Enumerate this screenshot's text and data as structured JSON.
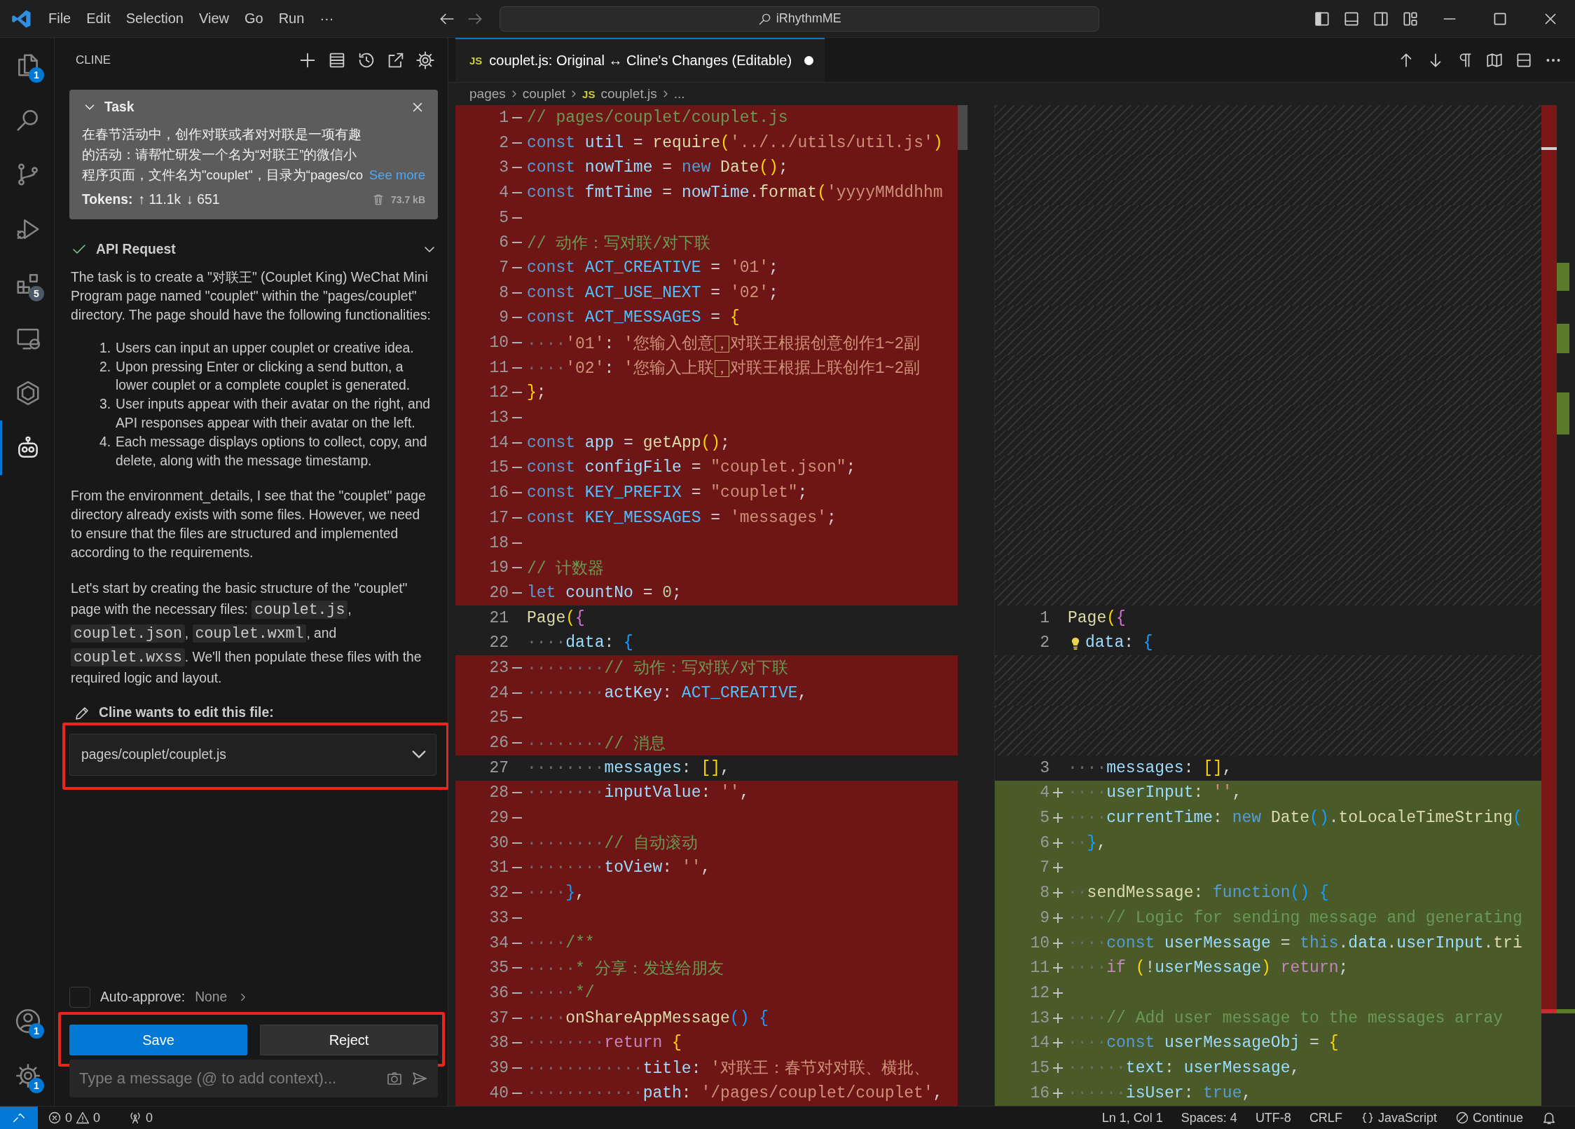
{
  "title_bar": {
    "menus": [
      "File",
      "Edit",
      "Selection",
      "View",
      "Go",
      "Run",
      "···"
    ],
    "command_center": "iRhythmME"
  },
  "activity_bar": {
    "items": [
      {
        "kind": "explorer",
        "badge": "1",
        "selected": false
      },
      {
        "kind": "search",
        "selected": false
      },
      {
        "kind": "scm",
        "selected": false
      },
      {
        "kind": "debug",
        "selected": false
      },
      {
        "kind": "extensions",
        "badge": "5",
        "selected": false
      },
      {
        "kind": "remote",
        "selected": false
      },
      {
        "kind": "hexagon",
        "selected": false
      },
      {
        "kind": "robot",
        "selected": true
      }
    ],
    "bottom": [
      {
        "kind": "account",
        "badge": "1"
      },
      {
        "kind": "settings",
        "badge": "1"
      }
    ]
  },
  "sidebar": {
    "title": "CLINE",
    "task": {
      "heading": "Task",
      "text": "在春节活动中，创作对联或者对对联是一项有趣的活动：请帮忙研发一个名为“对联王”的微信小程序页面，文件名为\"couplet\"，目录为“pages/co",
      "see_more": "See more",
      "tokens_label": "Tokens:",
      "tokens_up": "↑ 11.1k",
      "tokens_down": "↓ 651",
      "size": "73.7 kB"
    },
    "api_request": {
      "title": "API Request",
      "expanded": false
    },
    "paragraphs_before": [
      "The task is to create a \"对联王\" (Couplet King) WeChat Mini Program page named \"couplet\" within the \"pages/couplet\" directory. The page should have the following functionalities:"
    ],
    "list": [
      {
        "number": "1.",
        "text": "Users can input an upper couplet or creative idea."
      },
      {
        "number": "2.",
        "text": "Upon pressing Enter or clicking a send button, a lower couplet or a complete couplet is generated."
      },
      {
        "number": "3.",
        "text": "User inputs appear with their avatar on the right, and API responses appear with their avatar on the left."
      },
      {
        "number": "4.",
        "text": "Each message displays options to collect, copy, and delete, along with the message timestamp."
      }
    ],
    "paragraphs_after": [
      [
        {
          "kind": "text",
          "text": "From the environment_details, I see that the \"couplet\" page directory already exists with some files. However, we need to ensure that the files are structured and implemented according to the requirements."
        }
      ],
      [
        {
          "kind": "text",
          "text": "Let's start by creating the basic structure of the \"couplet\" page with the necessary files: "
        },
        {
          "kind": "code",
          "text": "couplet.js"
        },
        {
          "kind": "text",
          "text": ", "
        },
        {
          "kind": "code",
          "text": "couplet.json"
        },
        {
          "kind": "text",
          "text": ", "
        },
        {
          "kind": "code",
          "text": "couplet.wxml"
        },
        {
          "kind": "text",
          "text": ", and "
        },
        {
          "kind": "code",
          "text": "couplet.wxss"
        },
        {
          "kind": "text",
          "text": ". We'll then populate these files with the required logic and layout."
        }
      ]
    ],
    "edit_request": {
      "label": "Cline wants to edit this file:",
      "file": "pages/couplet/couplet.js"
    },
    "auto_approve": {
      "label": "Auto-approve:",
      "value": "None",
      "checked": false
    },
    "buttons": [
      {
        "label": "Save",
        "primary": true
      },
      {
        "label": "Reject",
        "primary": false
      }
    ],
    "input": {
      "placeholder": "Type a message (@ to add context)..."
    }
  },
  "editor": {
    "tab": {
      "icon_text": "JS",
      "title": "couplet.js: Original ↔ Cline's Changes (Editable)",
      "dirty": true
    },
    "breadcrumb": [
      {
        "text": "pages"
      },
      {
        "text": "couplet"
      },
      {
        "text": "couplet.js",
        "icon_text": "JS"
      },
      {
        "text": "..."
      }
    ],
    "left_pane": {
      "lines": [
        {
          "number": "1",
          "removed": true,
          "tokens": [
            {
              "kind": "comment",
              "text": "// pages/couplet/couplet.js"
            }
          ]
        },
        {
          "number": "2",
          "removed": true,
          "tokens": [
            {
              "kind": "keyword",
              "text": "const "
            },
            {
              "kind": "name",
              "text": "util"
            },
            {
              "kind": "punct",
              "text": " = "
            },
            {
              "kind": "func",
              "text": "require"
            },
            {
              "kind": "gold",
              "text": "("
            },
            {
              "kind": "string",
              "text": "'../../utils/util.js'"
            },
            {
              "kind": "gold",
              "text": ")"
            }
          ]
        },
        {
          "number": "3",
          "removed": true,
          "tokens": [
            {
              "kind": "keyword",
              "text": "const "
            },
            {
              "kind": "name",
              "text": "nowTime"
            },
            {
              "kind": "punct",
              "text": " = "
            },
            {
              "kind": "keyword",
              "text": "new "
            },
            {
              "kind": "func",
              "text": "Date"
            },
            {
              "kind": "gold",
              "text": "()"
            },
            {
              "kind": "punct",
              "text": ";"
            }
          ]
        },
        {
          "number": "4",
          "removed": true,
          "tokens": [
            {
              "kind": "keyword",
              "text": "const "
            },
            {
              "kind": "name",
              "text": "fmtTime"
            },
            {
              "kind": "punct",
              "text": " = "
            },
            {
              "kind": "name",
              "text": "nowTime"
            },
            {
              "kind": "punct",
              "text": "."
            },
            {
              "kind": "func",
              "text": "format"
            },
            {
              "kind": "gold",
              "text": "("
            },
            {
              "kind": "string",
              "text": "'yyyyMMddhhm"
            }
          ]
        },
        {
          "number": "5",
          "removed": true
        },
        {
          "number": "6",
          "removed": true,
          "tokens": [
            {
              "kind": "comment",
              "text": "// 动作：写对联/对下联"
            }
          ]
        },
        {
          "number": "7",
          "removed": true,
          "tokens": [
            {
              "kind": "keyword",
              "text": "const "
            },
            {
              "kind": "const",
              "text": "ACT_CREATIVE"
            },
            {
              "kind": "punct",
              "text": " = "
            },
            {
              "kind": "string",
              "text": "'01'"
            },
            {
              "kind": "punct",
              "text": ";"
            }
          ]
        },
        {
          "number": "8",
          "removed": true,
          "tokens": [
            {
              "kind": "keyword",
              "text": "const "
            },
            {
              "kind": "const",
              "text": "ACT_USE_NEXT"
            },
            {
              "kind": "punct",
              "text": " = "
            },
            {
              "kind": "string",
              "text": "'02'"
            },
            {
              "kind": "punct",
              "text": ";"
            }
          ]
        },
        {
          "number": "9",
          "removed": true,
          "tokens": [
            {
              "kind": "keyword",
              "text": "const "
            },
            {
              "kind": "const",
              "text": "ACT_MESSAGES"
            },
            {
              "kind": "punct",
              "text": " = "
            },
            {
              "kind": "gold",
              "text": "{"
            }
          ]
        },
        {
          "number": "10",
          "removed": true,
          "tokens": [
            {
              "kind": "space",
              "text": "····"
            },
            {
              "kind": "string",
              "text": "'01'"
            },
            {
              "kind": "punct",
              "text": ": "
            },
            {
              "kind": "string",
              "text": "'您输入创意"
            },
            {
              "kind": "flag",
              "text": "，"
            },
            {
              "kind": "string",
              "text": "对联王根据创意创作1~2副"
            }
          ]
        },
        {
          "number": "11",
          "removed": true,
          "tokens": [
            {
              "kind": "space",
              "text": "····"
            },
            {
              "kind": "string",
              "text": "'02'"
            },
            {
              "kind": "punct",
              "text": ": "
            },
            {
              "kind": "string",
              "text": "'您输入上联"
            },
            {
              "kind": "flag",
              "text": "，"
            },
            {
              "kind": "string",
              "text": "对联王根据上联创作1~2副"
            }
          ]
        },
        {
          "number": "12",
          "removed": true,
          "tokens": [
            {
              "kind": "gold",
              "text": "}"
            },
            {
              "kind": "punct",
              "text": ";"
            }
          ]
        },
        {
          "number": "13",
          "removed": true
        },
        {
          "number": "14",
          "removed": true,
          "tokens": [
            {
              "kind": "keyword",
              "text": "const "
            },
            {
              "kind": "name",
              "text": "app"
            },
            {
              "kind": "punct",
              "text": " = "
            },
            {
              "kind": "func",
              "text": "getApp"
            },
            {
              "kind": "gold",
              "text": "()"
            },
            {
              "kind": "punct",
              "text": ";"
            }
          ]
        },
        {
          "number": "15",
          "removed": true,
          "tokens": [
            {
              "kind": "keyword",
              "text": "const "
            },
            {
              "kind": "name",
              "text": "configFile"
            },
            {
              "kind": "punct",
              "text": " = "
            },
            {
              "kind": "string",
              "text": "\"couplet.json\""
            },
            {
              "kind": "punct",
              "text": ";"
            }
          ]
        },
        {
          "number": "16",
          "removed": true,
          "tokens": [
            {
              "kind": "keyword",
              "text": "const "
            },
            {
              "kind": "const",
              "text": "KEY_PREFIX"
            },
            {
              "kind": "punct",
              "text": " = "
            },
            {
              "kind": "string",
              "text": "\"couplet\""
            },
            {
              "kind": "punct",
              "text": ";"
            }
          ]
        },
        {
          "number": "17",
          "removed": true,
          "tokens": [
            {
              "kind": "keyword",
              "text": "const "
            },
            {
              "kind": "const",
              "text": "KEY_MESSAGES"
            },
            {
              "kind": "punct",
              "text": " = "
            },
            {
              "kind": "string",
              "text": "'messages'"
            },
            {
              "kind": "punct",
              "text": ";"
            }
          ]
        },
        {
          "number": "18",
          "removed": true
        },
        {
          "number": "19",
          "removed": true,
          "tokens": [
            {
              "kind": "comment",
              "text": "// 计数器"
            }
          ]
        },
        {
          "number": "20",
          "removed": true,
          "tokens": [
            {
              "kind": "keyword",
              "text": "let "
            },
            {
              "kind": "name",
              "text": "countNo"
            },
            {
              "kind": "punct",
              "text": " = "
            },
            {
              "kind": "number",
              "text": "0"
            },
            {
              "kind": "punct",
              "text": ";"
            }
          ]
        },
        {
          "number": "21",
          "removed": false,
          "tokens": [
            {
              "kind": "func",
              "text": "Page"
            },
            {
              "kind": "gold",
              "text": "("
            },
            {
              "kind": "purple",
              "text": "{"
            }
          ]
        },
        {
          "number": "22",
          "removed": false,
          "tokens": [
            {
              "kind": "space",
              "text": "····"
            },
            {
              "kind": "name",
              "text": "data"
            },
            {
              "kind": "punct",
              "text": ": "
            },
            {
              "kind": "blue",
              "text": "{"
            }
          ]
        },
        {
          "number": "23",
          "removed": true,
          "tokens": [
            {
              "kind": "space",
              "text": "········"
            },
            {
              "kind": "comment",
              "text": "// 动作：写对联/对下联"
            }
          ]
        },
        {
          "number": "24",
          "removed": true,
          "tokens": [
            {
              "kind": "space",
              "text": "········"
            },
            {
              "kind": "name",
              "text": "actKey"
            },
            {
              "kind": "punct",
              "text": ": "
            },
            {
              "kind": "const",
              "text": "ACT_CREATIVE"
            },
            {
              "kind": "punct",
              "text": ","
            }
          ]
        },
        {
          "number": "25",
          "removed": true
        },
        {
          "number": "26",
          "removed": true,
          "tokens": [
            {
              "kind": "space",
              "text": "········"
            },
            {
              "kind": "comment",
              "text": "// 消息"
            }
          ]
        },
        {
          "number": "27",
          "removed": false,
          "tokens": [
            {
              "kind": "space",
              "text": "········"
            },
            {
              "kind": "name",
              "text": "messages"
            },
            {
              "kind": "punct",
              "text": ": "
            },
            {
              "kind": "gold",
              "text": "[]"
            },
            {
              "kind": "punct",
              "text": ","
            }
          ]
        },
        {
          "number": "28",
          "removed": true,
          "tokens": [
            {
              "kind": "space",
              "text": "········"
            },
            {
              "kind": "name",
              "text": "inputValue"
            },
            {
              "kind": "punct",
              "text": ": "
            },
            {
              "kind": "string",
              "text": "''"
            },
            {
              "kind": "punct",
              "text": ","
            }
          ]
        },
        {
          "number": "29",
          "removed": true
        },
        {
          "number": "30",
          "removed": true,
          "tokens": [
            {
              "kind": "space",
              "text": "········"
            },
            {
              "kind": "comment",
              "text": "// 自动滚动"
            }
          ]
        },
        {
          "number": "31",
          "removed": true,
          "tokens": [
            {
              "kind": "space",
              "text": "········"
            },
            {
              "kind": "name",
              "text": "toView"
            },
            {
              "kind": "punct",
              "text": ": "
            },
            {
              "kind": "string",
              "text": "''"
            },
            {
              "kind": "punct",
              "text": ","
            }
          ]
        },
        {
          "number": "32",
          "removed": true,
          "tokens": [
            {
              "kind": "space",
              "text": "····"
            },
            {
              "kind": "blue",
              "text": "}"
            },
            {
              "kind": "punct",
              "text": ","
            }
          ]
        },
        {
          "number": "33",
          "removed": true
        },
        {
          "number": "34",
          "removed": true,
          "tokens": [
            {
              "kind": "space",
              "text": "····"
            },
            {
              "kind": "comment",
              "text": "/**"
            }
          ]
        },
        {
          "number": "35",
          "removed": true,
          "tokens": [
            {
              "kind": "space",
              "text": "·····"
            },
            {
              "kind": "comment",
              "text": "* 分享：发送给朋友"
            }
          ]
        },
        {
          "number": "36",
          "removed": true,
          "tokens": [
            {
              "kind": "space",
              "text": "·····"
            },
            {
              "kind": "comment",
              "text": "*/"
            }
          ]
        },
        {
          "number": "37",
          "removed": true,
          "tokens": [
            {
              "kind": "space",
              "text": "····"
            },
            {
              "kind": "func",
              "text": "onShareAppMessage"
            },
            {
              "kind": "blue",
              "text": "() {"
            }
          ]
        },
        {
          "number": "38",
          "removed": true,
          "tokens": [
            {
              "kind": "space",
              "text": "········"
            },
            {
              "kind": "control",
              "text": "return "
            },
            {
              "kind": "gold",
              "text": "{"
            }
          ]
        },
        {
          "number": "39",
          "removed": true,
          "tokens": [
            {
              "kind": "space",
              "text": "············"
            },
            {
              "kind": "name",
              "text": "title"
            },
            {
              "kind": "punct",
              "text": ": "
            },
            {
              "kind": "string",
              "text": "'对联王：春节对对联、横批、"
            }
          ]
        },
        {
          "number": "40",
          "removed": true,
          "tokens": [
            {
              "kind": "space",
              "text": "············"
            },
            {
              "kind": "name",
              "text": "path"
            },
            {
              "kind": "punct",
              "text": ": "
            },
            {
              "kind": "string",
              "text": "'/pages/couplet/couplet'"
            },
            {
              "kind": "punct",
              "text": ","
            }
          ]
        }
      ]
    },
    "right_pane": {
      "rows": [
        {
          "kind": "filler"
        },
        {
          "kind": "filler"
        },
        {
          "kind": "filler"
        },
        {
          "kind": "filler"
        },
        {
          "kind": "filler"
        },
        {
          "kind": "filler"
        },
        {
          "kind": "filler"
        },
        {
          "kind": "filler"
        },
        {
          "kind": "filler"
        },
        {
          "kind": "filler"
        },
        {
          "kind": "filler"
        },
        {
          "kind": "filler"
        },
        {
          "kind": "filler"
        },
        {
          "kind": "filler"
        },
        {
          "kind": "filler"
        },
        {
          "kind": "filler"
        },
        {
          "kind": "filler"
        },
        {
          "kind": "filler"
        },
        {
          "kind": "filler"
        },
        {
          "kind": "filler"
        },
        {
          "kind": "line",
          "number": "1",
          "added": false,
          "lightbulb": false,
          "tokens": [
            {
              "kind": "func",
              "text": "Page"
            },
            {
              "kind": "gold",
              "text": "("
            },
            {
              "kind": "purple",
              "text": "{"
            }
          ]
        },
        {
          "kind": "line",
          "number": "2",
          "added": false,
          "lightbulb": true,
          "tokens": [
            {
              "kind": "name",
              "text": "data"
            },
            {
              "kind": "punct",
              "text": ": "
            },
            {
              "kind": "blue",
              "text": "{"
            }
          ]
        },
        {
          "kind": "filler"
        },
        {
          "kind": "filler"
        },
        {
          "kind": "filler"
        },
        {
          "kind": "filler"
        },
        {
          "kind": "line",
          "number": "3",
          "added": false,
          "lightbulb": false,
          "tokens": [
            {
              "kind": "space",
              "text": "····"
            },
            {
              "kind": "name",
              "text": "messages"
            },
            {
              "kind": "punct",
              "text": ": "
            },
            {
              "kind": "gold",
              "text": "[]"
            },
            {
              "kind": "punct",
              "text": ","
            }
          ]
        },
        {
          "kind": "line",
          "number": "4",
          "added": true,
          "lightbulb": false,
          "tokens": [
            {
              "kind": "space",
              "text": "····"
            },
            {
              "kind": "name",
              "text": "userInput"
            },
            {
              "kind": "punct",
              "text": ": "
            },
            {
              "kind": "string",
              "text": "''"
            },
            {
              "kind": "punct",
              "text": ","
            }
          ]
        },
        {
          "kind": "line",
          "number": "5",
          "added": true,
          "lightbulb": false,
          "tokens": [
            {
              "kind": "space",
              "text": "····"
            },
            {
              "kind": "name",
              "text": "currentTime"
            },
            {
              "kind": "punct",
              "text": ": "
            },
            {
              "kind": "keyword",
              "text": "new "
            },
            {
              "kind": "func",
              "text": "Date"
            },
            {
              "kind": "blue",
              "text": "()"
            },
            {
              "kind": "punct",
              "text": "."
            },
            {
              "kind": "func",
              "text": "toLocaleTimeString"
            },
            {
              "kind": "blue",
              "text": "("
            }
          ]
        },
        {
          "kind": "line",
          "number": "6",
          "added": true,
          "lightbulb": false,
          "tokens": [
            {
              "kind": "space",
              "text": "··"
            },
            {
              "kind": "blue",
              "text": "}"
            },
            {
              "kind": "punct",
              "text": ","
            }
          ]
        },
        {
          "kind": "line",
          "number": "7",
          "added": true,
          "lightbulb": false
        },
        {
          "kind": "line",
          "number": "8",
          "added": true,
          "lightbulb": false,
          "tokens": [
            {
              "kind": "space",
              "text": "··"
            },
            {
              "kind": "func",
              "text": "sendMessage"
            },
            {
              "kind": "punct",
              "text": ": "
            },
            {
              "kind": "keyword",
              "text": "function"
            },
            {
              "kind": "blue",
              "text": "() {"
            }
          ]
        },
        {
          "kind": "line",
          "number": "9",
          "added": true,
          "lightbulb": false,
          "tokens": [
            {
              "kind": "space",
              "text": "····"
            },
            {
              "kind": "comment",
              "text": "// Logic for sending message and generating"
            }
          ]
        },
        {
          "kind": "line",
          "number": "10",
          "added": true,
          "lightbulb": false,
          "tokens": [
            {
              "kind": "space",
              "text": "····"
            },
            {
              "kind": "keyword",
              "text": "const "
            },
            {
              "kind": "name",
              "text": "userMessage"
            },
            {
              "kind": "punct",
              "text": " = "
            },
            {
              "kind": "keyword",
              "text": "this"
            },
            {
              "kind": "punct",
              "text": "."
            },
            {
              "kind": "name",
              "text": "data"
            },
            {
              "kind": "punct",
              "text": "."
            },
            {
              "kind": "name",
              "text": "userInput"
            },
            {
              "kind": "punct",
              "text": "."
            },
            {
              "kind": "func",
              "text": "tri"
            }
          ]
        },
        {
          "kind": "line",
          "number": "11",
          "added": true,
          "lightbulb": false,
          "tokens": [
            {
              "kind": "space",
              "text": "····"
            },
            {
              "kind": "control",
              "text": "if "
            },
            {
              "kind": "gold",
              "text": "("
            },
            {
              "kind": "punct",
              "text": "!"
            },
            {
              "kind": "name",
              "text": "userMessage"
            },
            {
              "kind": "gold",
              "text": ") "
            },
            {
              "kind": "control",
              "text": "return"
            },
            {
              "kind": "punct",
              "text": ";"
            }
          ]
        },
        {
          "kind": "line",
          "number": "12",
          "added": true,
          "lightbulb": false
        },
        {
          "kind": "line",
          "number": "13",
          "added": true,
          "lightbulb": false,
          "tokens": [
            {
              "kind": "space",
              "text": "····"
            },
            {
              "kind": "comment",
              "text": "// Add user message to the messages array"
            }
          ]
        },
        {
          "kind": "line",
          "number": "14",
          "added": true,
          "lightbulb": false,
          "tokens": [
            {
              "kind": "space",
              "text": "····"
            },
            {
              "kind": "keyword",
              "text": "const "
            },
            {
              "kind": "name",
              "text": "userMessageObj"
            },
            {
              "kind": "punct",
              "text": " = "
            },
            {
              "kind": "gold",
              "text": "{"
            }
          ]
        },
        {
          "kind": "line",
          "number": "15",
          "added": true,
          "lightbulb": false,
          "tokens": [
            {
              "kind": "space",
              "text": "······"
            },
            {
              "kind": "name",
              "text": "text"
            },
            {
              "kind": "punct",
              "text": ": "
            },
            {
              "kind": "name",
              "text": "userMessage"
            },
            {
              "kind": "punct",
              "text": ","
            }
          ]
        },
        {
          "kind": "line",
          "number": "16",
          "added": true,
          "lightbulb": false,
          "tokens": [
            {
              "kind": "space",
              "text": "······"
            },
            {
              "kind": "name",
              "text": "isUser"
            },
            {
              "kind": "punct",
              "text": ": "
            },
            {
              "kind": "keyword",
              "text": "true"
            },
            {
              "kind": "punct",
              "text": ","
            }
          ]
        }
      ]
    }
  },
  "status_bar": {
    "errors": "0",
    "warnings": "0",
    "ports": "0",
    "items": [
      "Ln 1, Col 1",
      "Spaces: 4",
      "UTF-8",
      "CRLF"
    ],
    "language": "JavaScript",
    "continue": "Continue"
  }
}
